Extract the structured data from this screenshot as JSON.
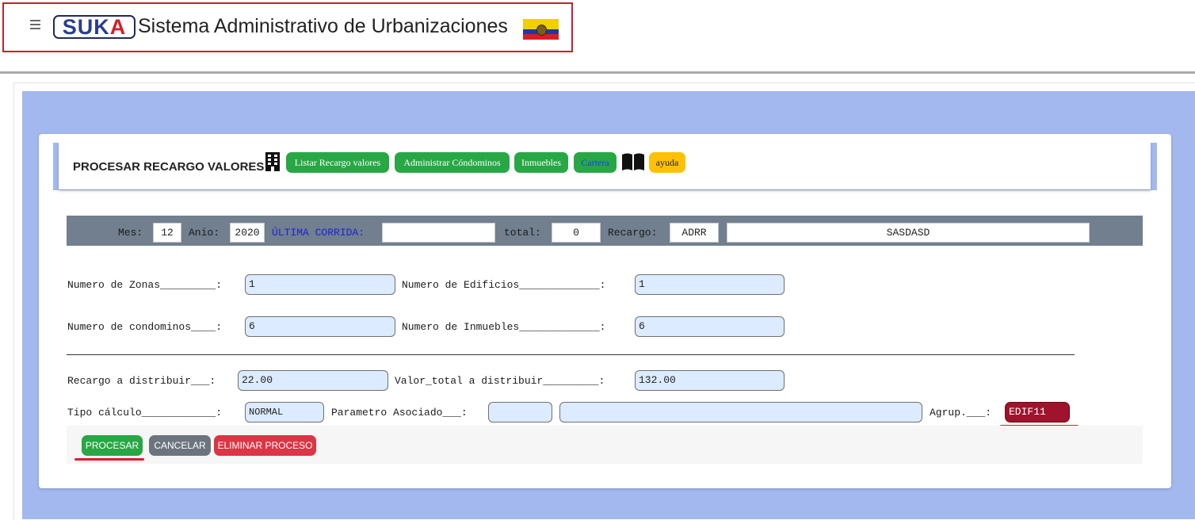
{
  "header": {
    "logo_part1": "SUK",
    "logo_part2": "A",
    "title": "Sistema Administrativo de Urbanizaciones"
  },
  "page": {
    "title": "PROCESAR RECARGO VALORES",
    "nav_buttons": [
      "Listar Recargo valores",
      "Administrar Cóndominos",
      "Inmuebles",
      "Cartera"
    ],
    "help_label": "ayuda"
  },
  "run_bar": {
    "mes_label": "Mes:",
    "mes_value": "12",
    "anio_label": "Anio:",
    "anio_value": "2020",
    "ultima_label": "ÚLTIMA CORRIDA:",
    "ultima_value": "",
    "total_label": "total:",
    "total_value": "0",
    "recargo_label": "Recargo:",
    "recargo_code": "ADRR",
    "recargo_name": "SASDASD"
  },
  "form": {
    "zonas_label": "Numero de Zonas_________:",
    "zonas_value": "1",
    "edificios_label": "Numero de Edificios_____________:",
    "edificios_value": "1",
    "condominos_label": "Numero de condominos____:",
    "condominos_value": "6",
    "inmuebles_label": "Numero de Inmuebles_____________:",
    "inmuebles_value": "6",
    "recargo_dist_label": "Recargo a distribuir___:",
    "recargo_dist_value": "22.00",
    "valor_total_label": "Valor_total a distribuir_________:",
    "valor_total_value": "132.00",
    "tipo_label": "Tipo cálculo____________:",
    "tipo_value": "NORMAL",
    "parametro_label": "Parametro Asociado___:",
    "parametro_code": "",
    "parametro_desc": "",
    "agrup_label": "Agrup.___:",
    "agrup_value": "EDIF11"
  },
  "actions": {
    "procesar": "PROCESAR",
    "cancelar": "CANCELAR",
    "eliminar": "ELIMINAR PROCESO"
  },
  "colors": {
    "accent_green": "#28a745",
    "danger_red": "#dc3545",
    "secondary_gray": "#6c757d",
    "warning_yellow": "#ffc107",
    "panel_blue": "#a3b8ef",
    "highlight_red": "#d81e2a"
  }
}
